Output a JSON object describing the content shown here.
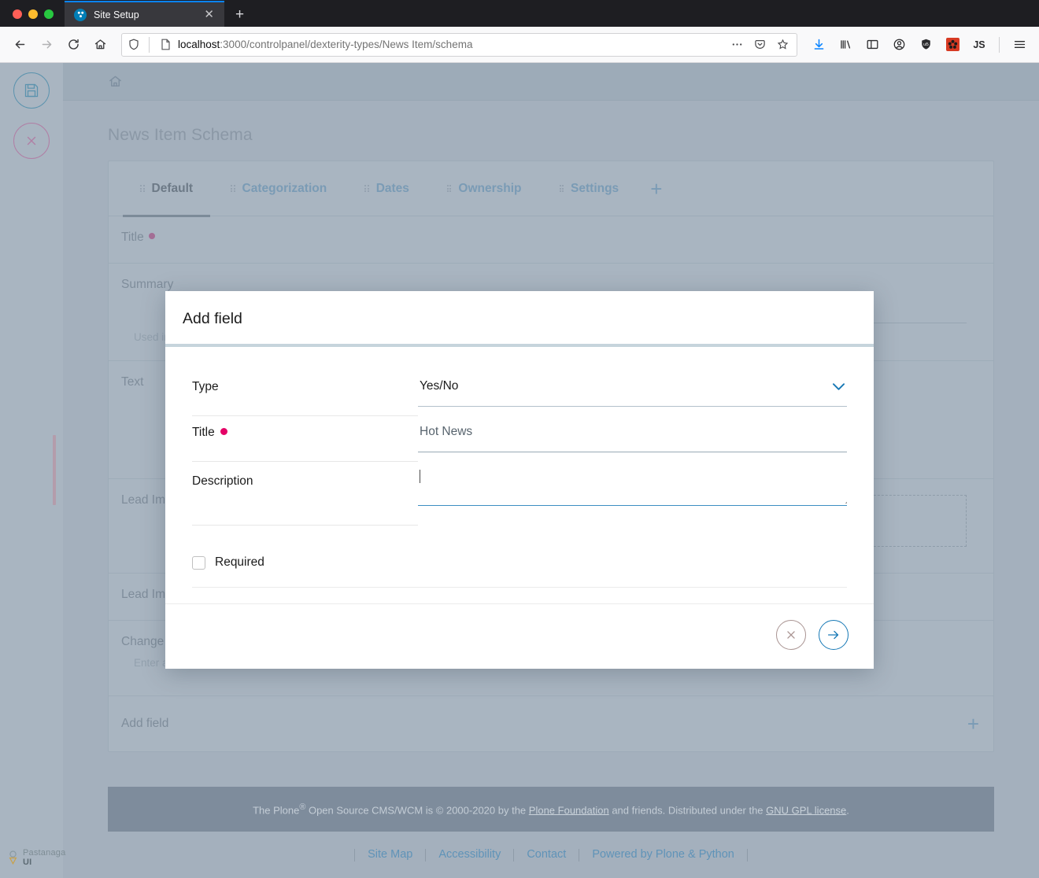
{
  "browser": {
    "tab": {
      "title": "Site Setup",
      "favicon_icon": "plone-logo-icon",
      "close_icon": "close-icon"
    },
    "new_tab_label": "+",
    "nav": {
      "back_icon": "back-arrow-icon",
      "forward_icon": "forward-arrow-icon",
      "reload_icon": "reload-icon",
      "home_icon": "home-icon"
    },
    "url": {
      "host": "localhost",
      "path": ":3000/controlpanel/dexterity-types/News Item/schema",
      "full": "localhost:3000/controlpanel/dexterity-types/News Item/schema",
      "shield_icon": "shield-icon",
      "page_icon": "page-icon",
      "more_icon": "ellipsis-icon",
      "pocket_icon": "pocket-icon",
      "bookmark_icon": "star-icon"
    },
    "toolbar_icons": [
      {
        "name": "downloads-icon",
        "label": ""
      },
      {
        "name": "library-icon",
        "label": ""
      },
      {
        "name": "sidebar-icon",
        "label": ""
      },
      {
        "name": "account-icon",
        "label": ""
      },
      {
        "name": "privacy-shield-icon",
        "label": ""
      },
      {
        "name": "extension-icon",
        "label": ""
      },
      {
        "name": "javascript-toggle-icon",
        "label": "JS"
      },
      {
        "name": "menu-icon",
        "label": ""
      }
    ]
  },
  "toolbar": {
    "save_icon": "save-floppy-icon",
    "cancel_icon": "close-circle-icon"
  },
  "branding": {
    "logo_text": "Pastanaga ",
    "logo_bold": "UI"
  },
  "breadcrumb": {
    "home_icon": "home-icon"
  },
  "page": {
    "title": "News Item Schema",
    "tabs": [
      {
        "label": "Default",
        "active": true
      },
      {
        "label": "Categorization",
        "active": false
      },
      {
        "label": "Dates",
        "active": false
      },
      {
        "label": "Ownership",
        "active": false
      },
      {
        "label": "Settings",
        "active": false
      }
    ],
    "add_tab_label": "+",
    "fields": [
      {
        "label": "Title",
        "required": true,
        "help": ""
      },
      {
        "label": "Summary",
        "required": false,
        "help": "Used in it"
      },
      {
        "label": "Text",
        "required": false,
        "help": ""
      },
      {
        "label": "Lead Ima",
        "required": false,
        "help": ""
      },
      {
        "label": "Lead Ima",
        "required": false,
        "help": ""
      },
      {
        "label": "Change Note",
        "required": false,
        "help": "Enter a comment that describes the changes you made."
      }
    ],
    "add_field": {
      "label": "Add field",
      "plus": "+"
    }
  },
  "footer": {
    "colophon_pre": "The Plone",
    "colophon_reg": "®",
    "colophon_mid": " Open Source CMS/WCM is © 2000-2020 by the ",
    "foundation_link": "Plone Foundation",
    "colophon_mid2": " and friends. Distributed under the ",
    "license_link": "GNU GPL license",
    "colophon_end": ".",
    "links": [
      {
        "label": "Site Map"
      },
      {
        "label": "Accessibility"
      },
      {
        "label": "Contact"
      },
      {
        "label": "Powered by Plone & Python"
      }
    ]
  },
  "modal": {
    "title": "Add field",
    "type": {
      "label": "Type",
      "value": "Yes/No",
      "chevron_icon": "chevron-down-icon"
    },
    "field_title": {
      "label": "Title",
      "required": true,
      "value": "Hot News",
      "placeholder": ""
    },
    "description": {
      "label": "Description",
      "value": "",
      "placeholder": "",
      "resize_icon": "resize-grip-icon"
    },
    "required": {
      "label": "Required",
      "checked": false
    },
    "actions": {
      "cancel_icon": "close-icon",
      "submit_icon": "arrow-right-icon"
    }
  },
  "colors": {
    "overlay": "#a4b0bd",
    "accent_blue": "#1779b6",
    "required_pink": "#e40166",
    "cancel_mauve": "#a99492",
    "tab_link": "#7a9bb5"
  }
}
